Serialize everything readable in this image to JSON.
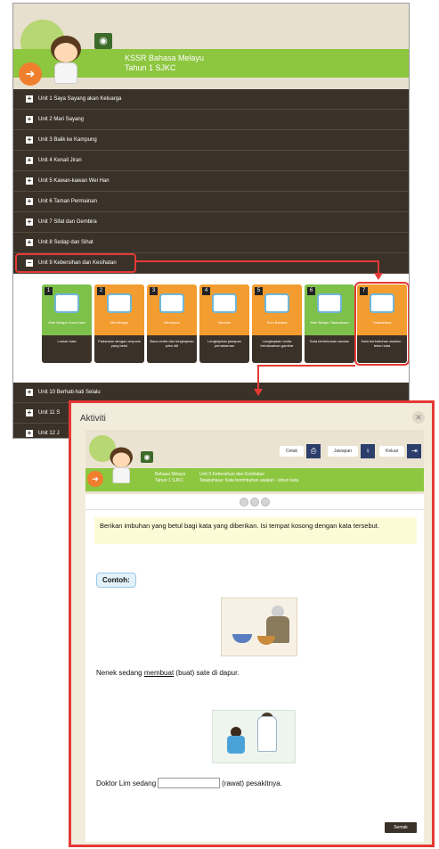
{
  "app": {
    "title_line1": "KSSR Bahasa Melayu",
    "title_line2": "Tahun 1 SJKC",
    "logo_icon": "eye-badge-icon",
    "back_icon": "back-arrow-icon"
  },
  "units": [
    {
      "label": "Unit 1 Saya Sayang akan Keluarga"
    },
    {
      "label": "Unit 2 Mari Sayang"
    },
    {
      "label": "Unit 3 Balik ke Kampung"
    },
    {
      "label": "Unit 4 Kenali Jiran"
    },
    {
      "label": "Unit 5 Kawan-kawan Wei Han"
    },
    {
      "label": "Unit 6 Taman Permainan"
    },
    {
      "label": "Unit 7 Sifat dan Gembira"
    },
    {
      "label": "Unit 8 Sedap dan Sihat"
    },
    {
      "label": "Unit 9 Kebersihan dan Kesihatan"
    }
  ],
  "activities": [
    {
      "num": "1",
      "title": "Mari Belajar Kosa Kata",
      "desc": "Lontan kata"
    },
    {
      "num": "2",
      "title": "Mendengar",
      "desc": "Padankan dengan respons yang betul"
    },
    {
      "num": "3",
      "title": "Membaca",
      "desc": "Baca cerita dan lengkapkan peta idit"
    },
    {
      "num": "4",
      "title": "Menulis",
      "desc": "Lengkapkan jawapan pemahaman"
    },
    {
      "num": "5",
      "title": "Seni Bahasa",
      "desc": "Lengkapkan cerita berdasarkan gambar"
    },
    {
      "num": "6",
      "title": "Mari Belajar Tatabahasa",
      "desc": "Kata berimbuhan awalan"
    },
    {
      "num": "7",
      "title": "Tatabahasa",
      "desc": "Kata berimbuhan awalan - lebun kata"
    }
  ],
  "units_after": [
    {
      "label": "Unit 10 Berhati-hati Selalu"
    },
    {
      "label": "Unit 11 S"
    },
    {
      "label": "Unit 12 J"
    }
  ],
  "popup": {
    "title": "Aktiviti",
    "toolbar": {
      "print_label": "Cetak",
      "answer_label": "Jawapan",
      "exit_label": "Keluar"
    },
    "meta": {
      "subject": "Bahasa Melayu",
      "year": "Tahun 1 SJKC",
      "unit": "Unit 9 Kebersihan dan Kesihatan",
      "activity": "Tatabahasa: Kata berimbuhan awalan - lebun kata"
    },
    "instruction": "Berikan imbuhan yang betul bagi kata yang diberikan. Isi tempat kosong dengan kata tersebut.",
    "example_label": "Contoh:",
    "sentence1": {
      "before": "Nenek sedang ",
      "answer": "membuat",
      "after": " (buat) sate di dapur."
    },
    "sentence2": {
      "before": "Doktor Lim sedang",
      "input_value": "",
      "after": "(rawat) pesakitnya."
    },
    "submit_label": "Semak"
  }
}
